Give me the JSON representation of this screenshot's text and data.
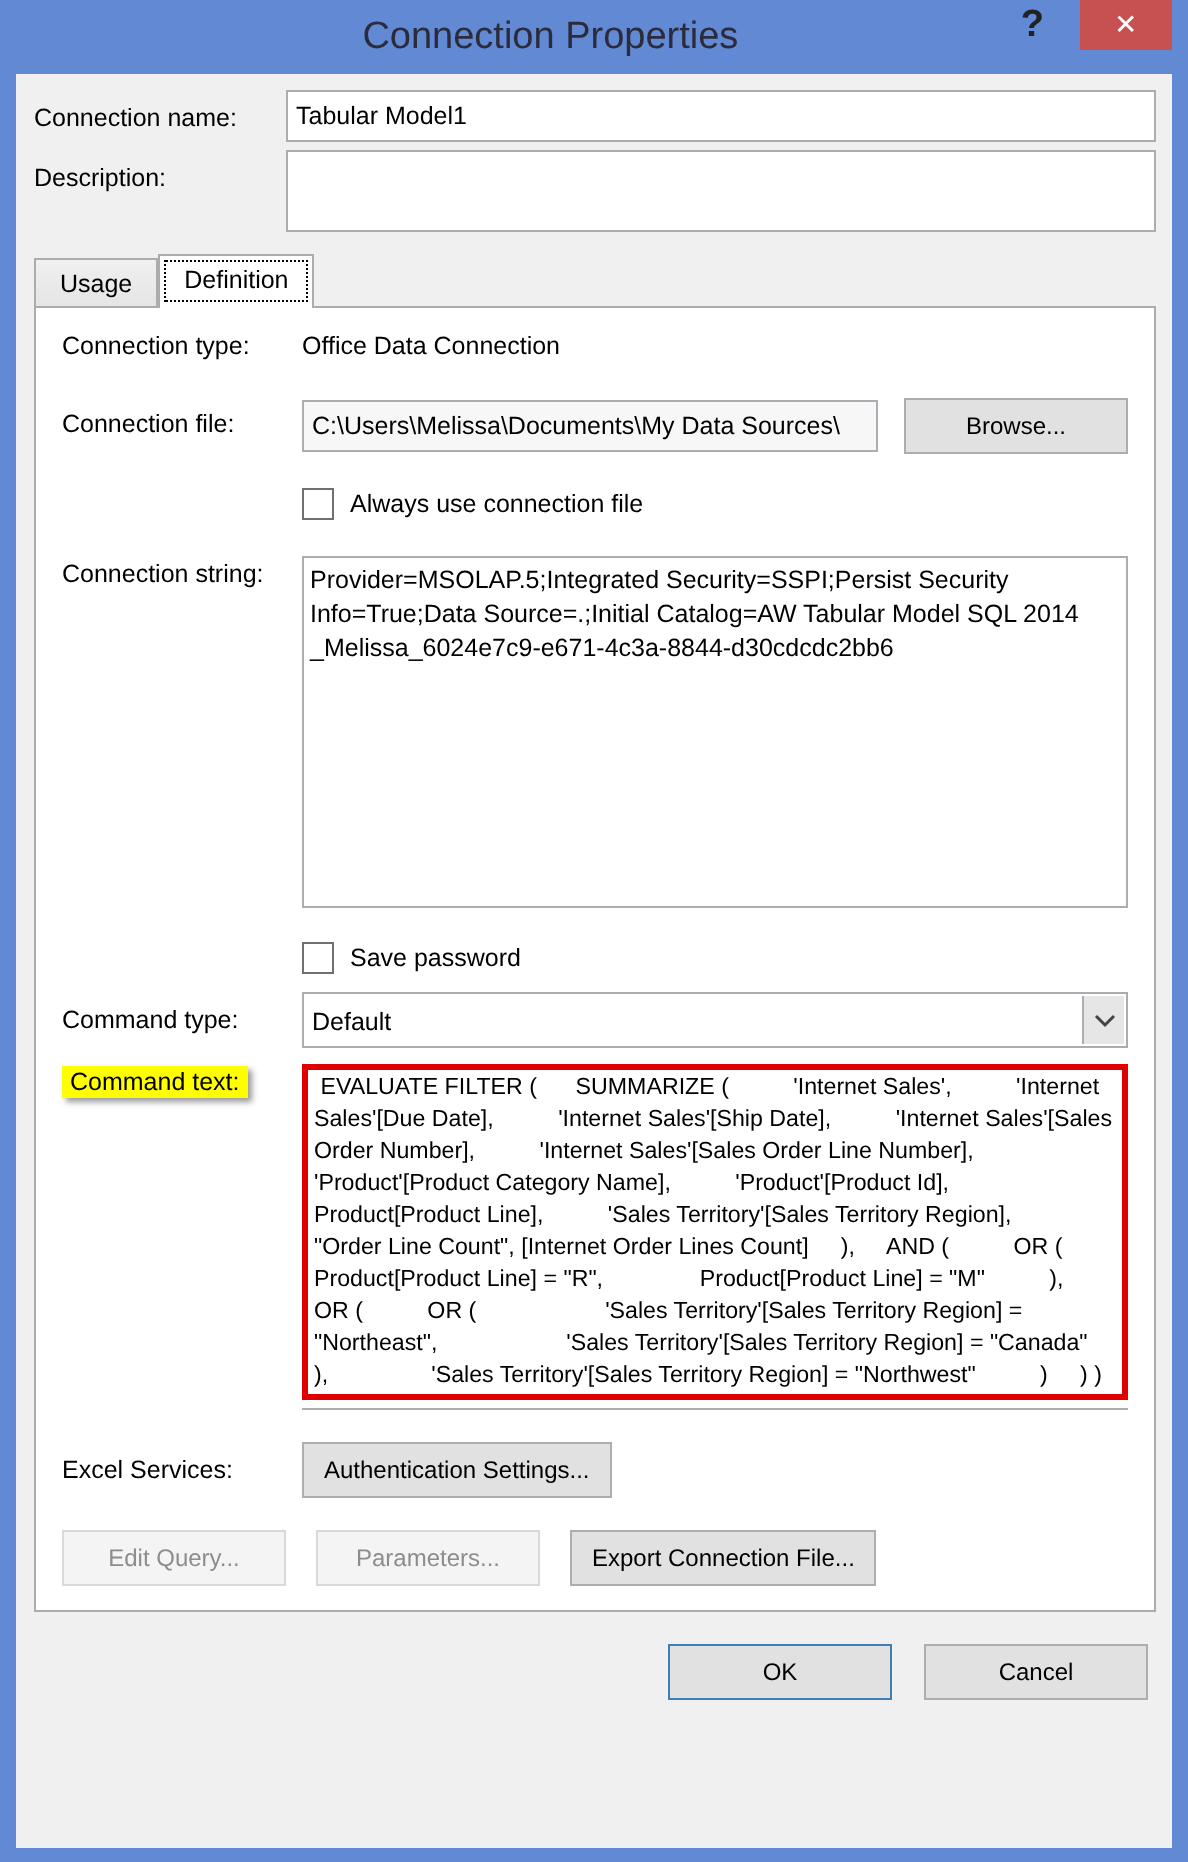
{
  "window": {
    "title": "Connection Properties",
    "help": "?",
    "close": "✕"
  },
  "connection_name": {
    "label": "Connection name:",
    "value": "Tabular Model1"
  },
  "description": {
    "label": "Description:"
  },
  "tabs": [
    {
      "label": "Usage",
      "selected": false
    },
    {
      "label": "Definition",
      "selected": true
    }
  ],
  "definition": {
    "connection_type": {
      "label": "Connection type:",
      "value": "Office Data Connection"
    },
    "connection_file": {
      "label": "Connection file:",
      "value": "C:\\Users\\Melissa\\Documents\\My Data Sources\\",
      "button": "Browse..."
    },
    "always_use_file": {
      "label": "Always use connection file",
      "checked": false
    },
    "connection_string": {
      "label": "Connection string:",
      "value": "Provider=MSOLAP.5;Integrated Security=SSPI;Persist Security Info=True;Data Source=.;Initial Catalog=AW Tabular Model SQL 2014 _Melissa_6024e7c9-e671-4c3a-8844-d30cdcdc2bb6"
    },
    "save_password": {
      "label": "Save password",
      "checked": false
    },
    "command_type": {
      "label": "Command type:",
      "value": "Default"
    },
    "command_text": {
      "label": "Command text:",
      "highlighted": true,
      "value": " EVALUATE FILTER (      SUMMARIZE (          'Internet Sales',          'Internet Sales'[Due Date],          'Internet Sales'[Ship Date],          'Internet Sales'[Sales Order Number],          'Internet Sales'[Sales Order Line Number],          'Product'[Product Category Name],          'Product'[Product Id],          Product[Product Line],          'Sales Territory'[Sales Territory Region],          \"Order Line Count\", [Internet Order Lines Count]     ),     AND (          OR (               Product[Product Line] = \"R\",               Product[Product Line] = \"M\"          ),          OR (          OR (                    'Sales Territory'[Sales Territory Region] = \"Northeast\",                    'Sales Territory'[Sales Territory Region] = \"Canada\"               ),                'Sales Territory'[Sales Territory Region] = \"Northwest\"          )     ) )"
    },
    "excel_services": {
      "label": "Excel Services:",
      "button": "Authentication Settings..."
    },
    "buttons": [
      {
        "label": "Edit Query...",
        "disabled": true
      },
      {
        "label": "Parameters...",
        "disabled": true
      },
      {
        "label": "Export Connection File...",
        "disabled": false
      }
    ]
  },
  "footer_buttons": [
    {
      "label": "OK",
      "default": true
    },
    {
      "label": "Cancel",
      "default": false
    }
  ]
}
